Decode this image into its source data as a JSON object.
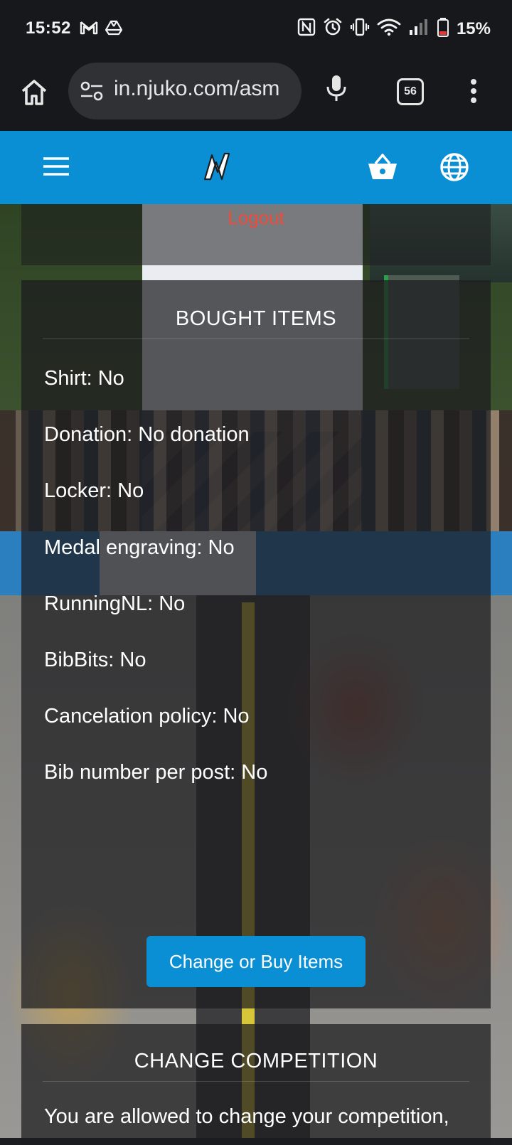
{
  "status_bar": {
    "time": "15:52",
    "left_icons": [
      "gmail-icon",
      "drive-icon"
    ],
    "right_icons": [
      "nfc-icon",
      "alarm-icon",
      "vibrate-icon",
      "wifi-icon",
      "signal-icon",
      "battery-icon"
    ],
    "battery": "15%",
    "battery_level_percent": 15,
    "battery_color": "#e53935"
  },
  "browser": {
    "url": "in.njuko.com/asm",
    "tab_count": "56",
    "icons": [
      "home-icon",
      "site-settings-icon",
      "mic-icon",
      "tab-switcher-icon",
      "more-vert-icon"
    ]
  },
  "site_header": {
    "accent_color": "#0a8fd4",
    "icons": [
      "hamburger-menu-icon",
      "njuko-logo",
      "basket-icon",
      "globe-icon"
    ]
  },
  "account": {
    "logout_label": "Logout"
  },
  "bought_items": {
    "title": "BOUGHT ITEMS",
    "items": [
      "Shirt: No",
      "Donation: No donation",
      "Locker: No",
      "Medal engraving: No",
      "RunningNL: No",
      "BibBits: No",
      "Cancelation policy: No",
      "Bib number per post: No"
    ],
    "button_label": "Change or Buy Items"
  },
  "change_competition": {
    "title": "CHANGE COMPETITION",
    "text": "You are allowed to change your competition,"
  }
}
